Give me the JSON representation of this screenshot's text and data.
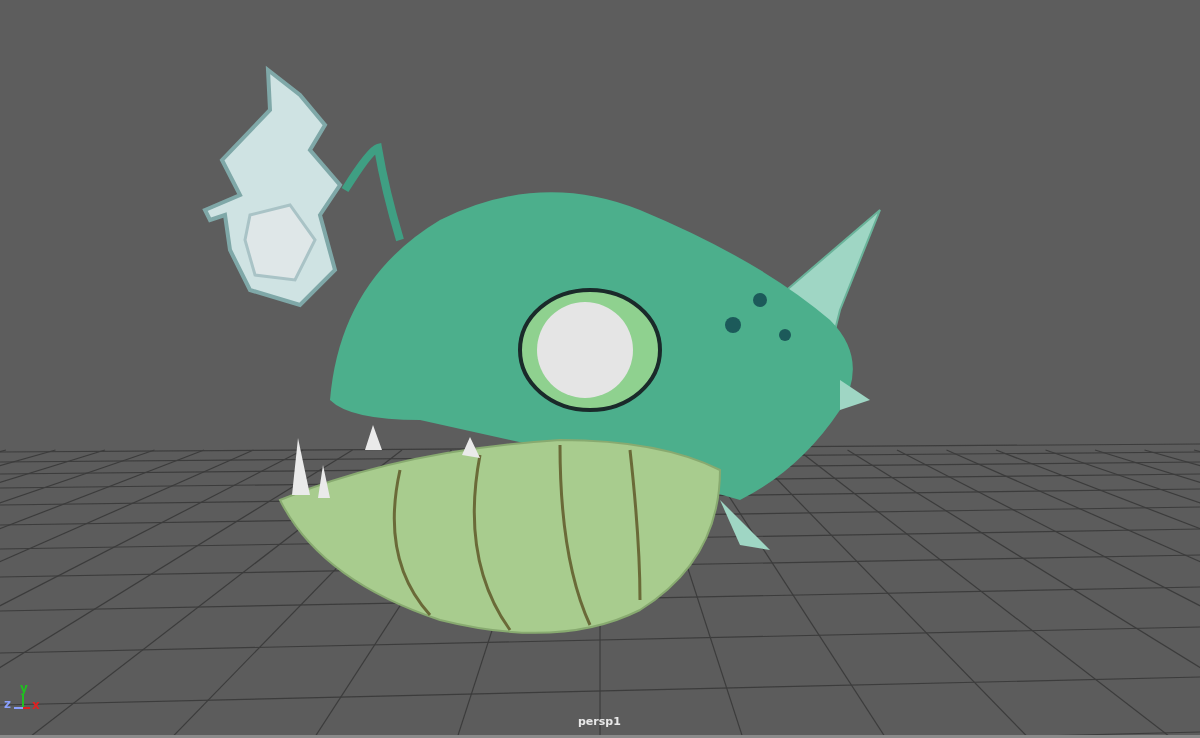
{
  "viewport": {
    "camera": "persp1"
  },
  "axes": [
    {
      "label": "y",
      "color": "#20c020"
    },
    {
      "label": "z",
      "color": "#8aa0ff"
    },
    {
      "label": "x",
      "color": "#e02020"
    }
  ]
}
